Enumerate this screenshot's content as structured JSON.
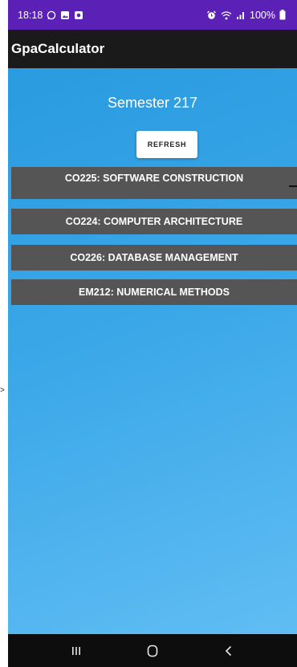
{
  "status_bar": {
    "time": "18:18",
    "battery": "100%"
  },
  "app_bar": {
    "title": "GpaCalculator"
  },
  "semester": {
    "title": "Semester 217"
  },
  "refresh_button": {
    "label": "REFRESH"
  },
  "courses": [
    {
      "label": "CO225: SOFTWARE CONSTRUCTION"
    },
    {
      "label": "CO224: COMPUTER ARCHITECTURE"
    },
    {
      "label": "CO226: DATABASE MANAGEMENT"
    },
    {
      "label": "EM212: NUMERICAL METHODS"
    }
  ],
  "colors": {
    "status_bar": "#5b21b6",
    "app_bar": "#1a1a1a",
    "background_gradient_start": "#2a9be0",
    "background_gradient_end": "#60bdf3",
    "course_item": "#555555"
  },
  "icons": {
    "status_left": [
      "whatsapp-icon",
      "gallery-icon",
      "notification-icon"
    ],
    "status_right": [
      "alarm-icon",
      "wifi-icon",
      "signal-icon",
      "battery-icon"
    ],
    "nav": [
      "recent-apps-icon",
      "home-icon",
      "back-icon"
    ]
  }
}
